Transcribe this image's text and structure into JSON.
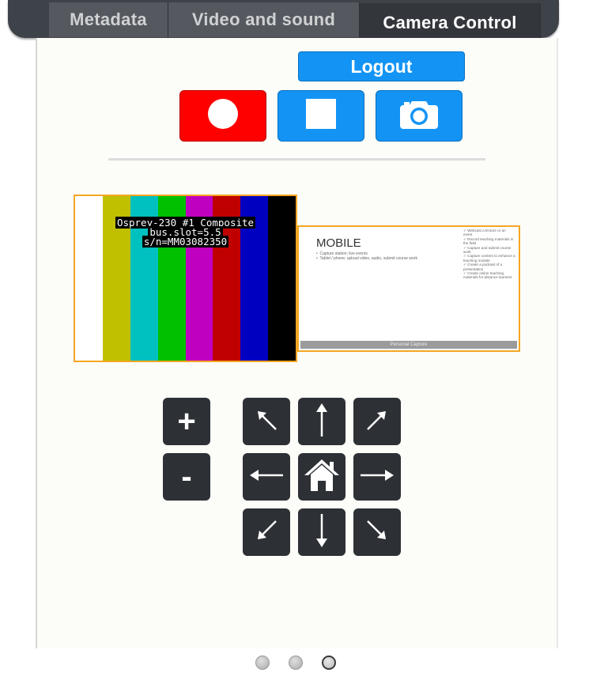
{
  "tabs": [
    {
      "label": "Metadata",
      "active": false
    },
    {
      "label": "Video and sound",
      "active": false
    },
    {
      "label": "Camera Control",
      "active": true
    }
  ],
  "logout_label": "Logout",
  "controls": {
    "record_icon": "record-icon",
    "stop_icon": "stop-icon",
    "snapshot_icon": "camera-icon"
  },
  "feeds": {
    "composite": {
      "osd_lines": [
        "Osprey-230 #1  Composite",
        "bus.slot=5.5",
        "s/n=MM03082350"
      ],
      "bar_colors": [
        "#ffffff",
        "#c0c000",
        "#00c0c0",
        "#00c000",
        "#c000c0",
        "#c00000",
        "#0000c0",
        "#000000"
      ]
    },
    "presentation": {
      "title": "MOBILE",
      "bullets": [
        "Capture station; live events",
        "Tablet / phone; upload video, audio, submit course work"
      ],
      "checklist": [
        "Webcast a lecture or an event",
        "Record teaching materials in the field",
        "Capture and submit course work",
        "Capture content to enhance a teaching module",
        "Create a podcast of a presentation",
        "Create online teaching materials for distance learners"
      ],
      "footer": "Personal Capture"
    }
  },
  "ptz": {
    "zoom_in": "+",
    "zoom_out": "-",
    "up_left": "↖",
    "up": "↑",
    "up_right": "↗",
    "left": "←",
    "home_icon": "home-icon",
    "right": "→",
    "down_left": "↙",
    "down": "↓",
    "down_right": "↘"
  },
  "pager": {
    "count": 3,
    "active_index": 2
  },
  "colors": {
    "accent": "#1394f5",
    "record": "#ff0000",
    "feed_border": "#f5a623",
    "ptz_bg": "#2d3035"
  }
}
